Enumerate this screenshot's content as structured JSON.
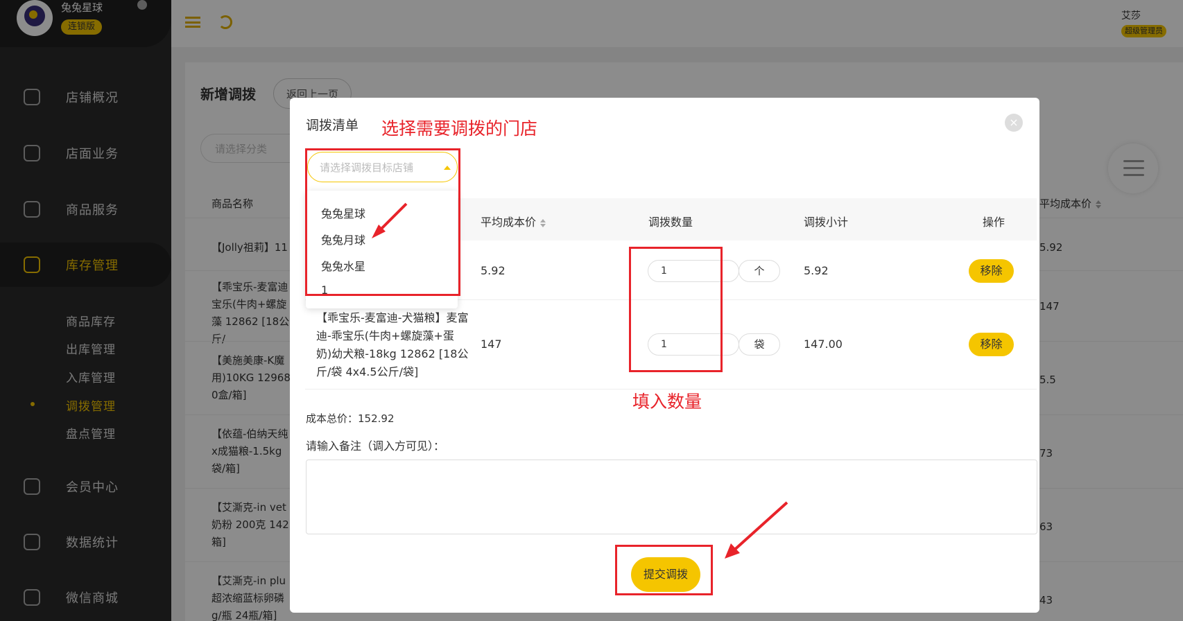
{
  "brand": {
    "name": "兔兔星球",
    "tag": "连锁版"
  },
  "user": {
    "name": "艾莎",
    "role": "超级管理员"
  },
  "nav": {
    "items": [
      {
        "label": "店铺概况"
      },
      {
        "label": "店面业务"
      },
      {
        "label": "商品服务"
      },
      {
        "label": "库存管理"
      },
      {
        "label": "会员中心"
      },
      {
        "label": "数据统计"
      },
      {
        "label": "微信商城"
      }
    ],
    "sub_items": [
      {
        "label": "商品库存"
      },
      {
        "label": "出库管理"
      },
      {
        "label": "入库管理"
      },
      {
        "label": "调拨管理"
      },
      {
        "label": "盘点管理"
      }
    ]
  },
  "page": {
    "title": "新增调拨",
    "back_label": "返回上一页",
    "category_placeholder": "请选择分类",
    "table_headers": {
      "name": "商品名称",
      "avg_cost": "平均成本价"
    },
    "rows": [
      {
        "name": "【Jolly祖莉】11",
        "cost": "5.92"
      },
      {
        "name": "【乖宝乐-麦富迪 宝乐(牛肉+螺旋藻 12862 [18公斤/",
        "cost": "147"
      },
      {
        "name": "【美施美康-K魔 用)10KG 12968 0盒/箱]",
        "cost": "5.5"
      },
      {
        "name": "【依蕴-伯纳天纯 x成猫粮-1.5kg 袋/箱]",
        "cost": "73"
      },
      {
        "name": "【艾澌克-in vet 奶粉 200克 142 箱]",
        "cost": "63"
      },
      {
        "name": "【艾澌克-in plu 超浓缩蓝标卵磷 g/瓶 24瓶/箱]",
        "cost": "43"
      }
    ]
  },
  "modal": {
    "title": "调拨清单",
    "close": "×",
    "store_placeholder": "请选择调拨目标店铺",
    "stores": [
      "兔兔星球",
      "兔兔月球",
      "兔兔水星",
      "1"
    ],
    "headers": {
      "avg_cost": "平均成本价",
      "qty": "调拨数量",
      "subtotal": "调拨小计",
      "action": "操作"
    },
    "rows": [
      {
        "name": "",
        "avg_cost": "5.92",
        "qty": "1",
        "unit": "个",
        "subtotal": "5.92",
        "action": "移除"
      },
      {
        "name": "【乖宝乐-麦富迪-犬猫粮】麦富迪-乖宝乐(牛肉+螺旋藻+蛋奶)幼犬粮-18kg 12862 [18公斤/袋 4x4.5公斤/袋]",
        "avg_cost": "147",
        "qty": "1",
        "unit": "袋",
        "subtotal": "147.00",
        "action": "移除"
      }
    ],
    "total_label": "成本总价：152.92",
    "remark_label": "请输入备注（调入方可见）：",
    "submit_label": "提交调拨"
  },
  "annotations": {
    "select_store": "选择需要调拨的门店",
    "fill_qty": "填入数量"
  },
  "colors": {
    "accent": "#f5c500",
    "annotation": "#e8232a",
    "sidebar": "#2b2b2b"
  }
}
